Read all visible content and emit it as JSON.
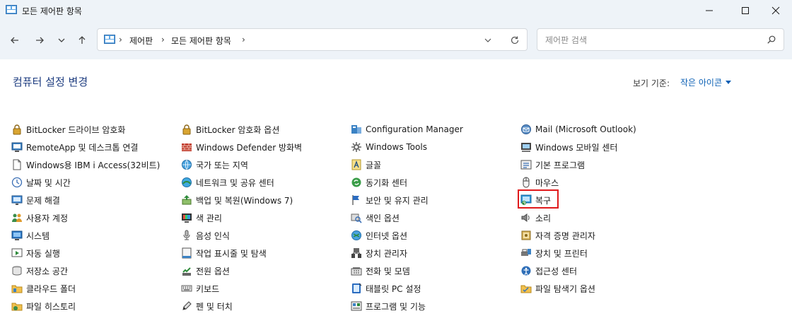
{
  "window": {
    "title": "모든 제어판 항목"
  },
  "address": {
    "crumbs": [
      "제어판",
      "모든 제어판 항목"
    ]
  },
  "search": {
    "placeholder": "제어판 검색"
  },
  "header": {
    "title": "컴퓨터 설정 변경",
    "viewby_label": "보기 기준:",
    "viewby_value": "작은 아이콘"
  },
  "columns": [
    {
      "items": [
        {
          "label": "BitLocker 드라이브 암호화",
          "icon": "bitlocker-key-icon"
        },
        {
          "label": "RemoteApp 및 데스크톱 연결",
          "icon": "remote-desktop-icon"
        },
        {
          "label": "Windows용 IBM i Access(32비트)",
          "icon": "document-icon"
        },
        {
          "label": "날짜 및 시간",
          "icon": "clock-icon"
        },
        {
          "label": "문제 해결",
          "icon": "troubleshoot-icon"
        },
        {
          "label": "사용자 계정",
          "icon": "users-icon"
        },
        {
          "label": "시스템",
          "icon": "monitor-icon"
        },
        {
          "label": "자동 실행",
          "icon": "autoplay-icon"
        },
        {
          "label": "저장소 공간",
          "icon": "storage-icon"
        },
        {
          "label": "클라우드 폴더",
          "icon": "cloud-folder-icon"
        },
        {
          "label": "파일 히스토리",
          "icon": "file-history-icon"
        }
      ]
    },
    {
      "items": [
        {
          "label": "BitLocker 암호화 옵션",
          "icon": "bitlocker-key-icon"
        },
        {
          "label": "Windows Defender 방화벽",
          "icon": "firewall-icon"
        },
        {
          "label": "국가 또는 지역",
          "icon": "globe-icon"
        },
        {
          "label": "네트워크 및 공유 센터",
          "icon": "network-icon"
        },
        {
          "label": "백업 및 복원(Windows 7)",
          "icon": "backup-icon"
        },
        {
          "label": "색 관리",
          "icon": "color-icon"
        },
        {
          "label": "음성 인식",
          "icon": "microphone-icon"
        },
        {
          "label": "작업 표시줄 및 탐색",
          "icon": "taskbar-icon"
        },
        {
          "label": "전원 옵션",
          "icon": "power-icon"
        },
        {
          "label": "키보드",
          "icon": "keyboard-icon"
        },
        {
          "label": "펜 및 터치",
          "icon": "pen-icon"
        }
      ]
    },
    {
      "items": [
        {
          "label": "Configuration Manager",
          "icon": "config-manager-icon"
        },
        {
          "label": "Windows Tools",
          "icon": "gear-icon"
        },
        {
          "label": "글꼴",
          "icon": "font-icon"
        },
        {
          "label": "동기화 센터",
          "icon": "sync-icon"
        },
        {
          "label": "보안 및 유지 관리",
          "icon": "flag-icon"
        },
        {
          "label": "색인 옵션",
          "icon": "indexing-icon"
        },
        {
          "label": "인터넷 옵션",
          "icon": "internet-icon"
        },
        {
          "label": "장치 관리자",
          "icon": "device-manager-icon"
        },
        {
          "label": "전화 및 모뎀",
          "icon": "phone-icon"
        },
        {
          "label": "태블릿 PC 설정",
          "icon": "tablet-icon"
        },
        {
          "label": "프로그램 및 기능",
          "icon": "programs-icon"
        }
      ]
    },
    {
      "items": [
        {
          "label": "Mail (Microsoft Outlook)",
          "icon": "mail-icon"
        },
        {
          "label": "Windows 모바일 센터",
          "icon": "mobility-icon"
        },
        {
          "label": "기본 프로그램",
          "icon": "default-programs-icon"
        },
        {
          "label": "마우스",
          "icon": "mouse-icon"
        },
        {
          "label": "복구",
          "icon": "recovery-icon"
        },
        {
          "label": "소리",
          "icon": "speaker-icon"
        },
        {
          "label": "자격 증명 관리자",
          "icon": "credential-icon"
        },
        {
          "label": "장치 및 프린터",
          "icon": "printer-icon"
        },
        {
          "label": "접근성 센터",
          "icon": "accessibility-icon"
        },
        {
          "label": "파일 탐색기 옵션",
          "icon": "folder-options-icon"
        }
      ]
    }
  ],
  "highlighted_item": "복구"
}
